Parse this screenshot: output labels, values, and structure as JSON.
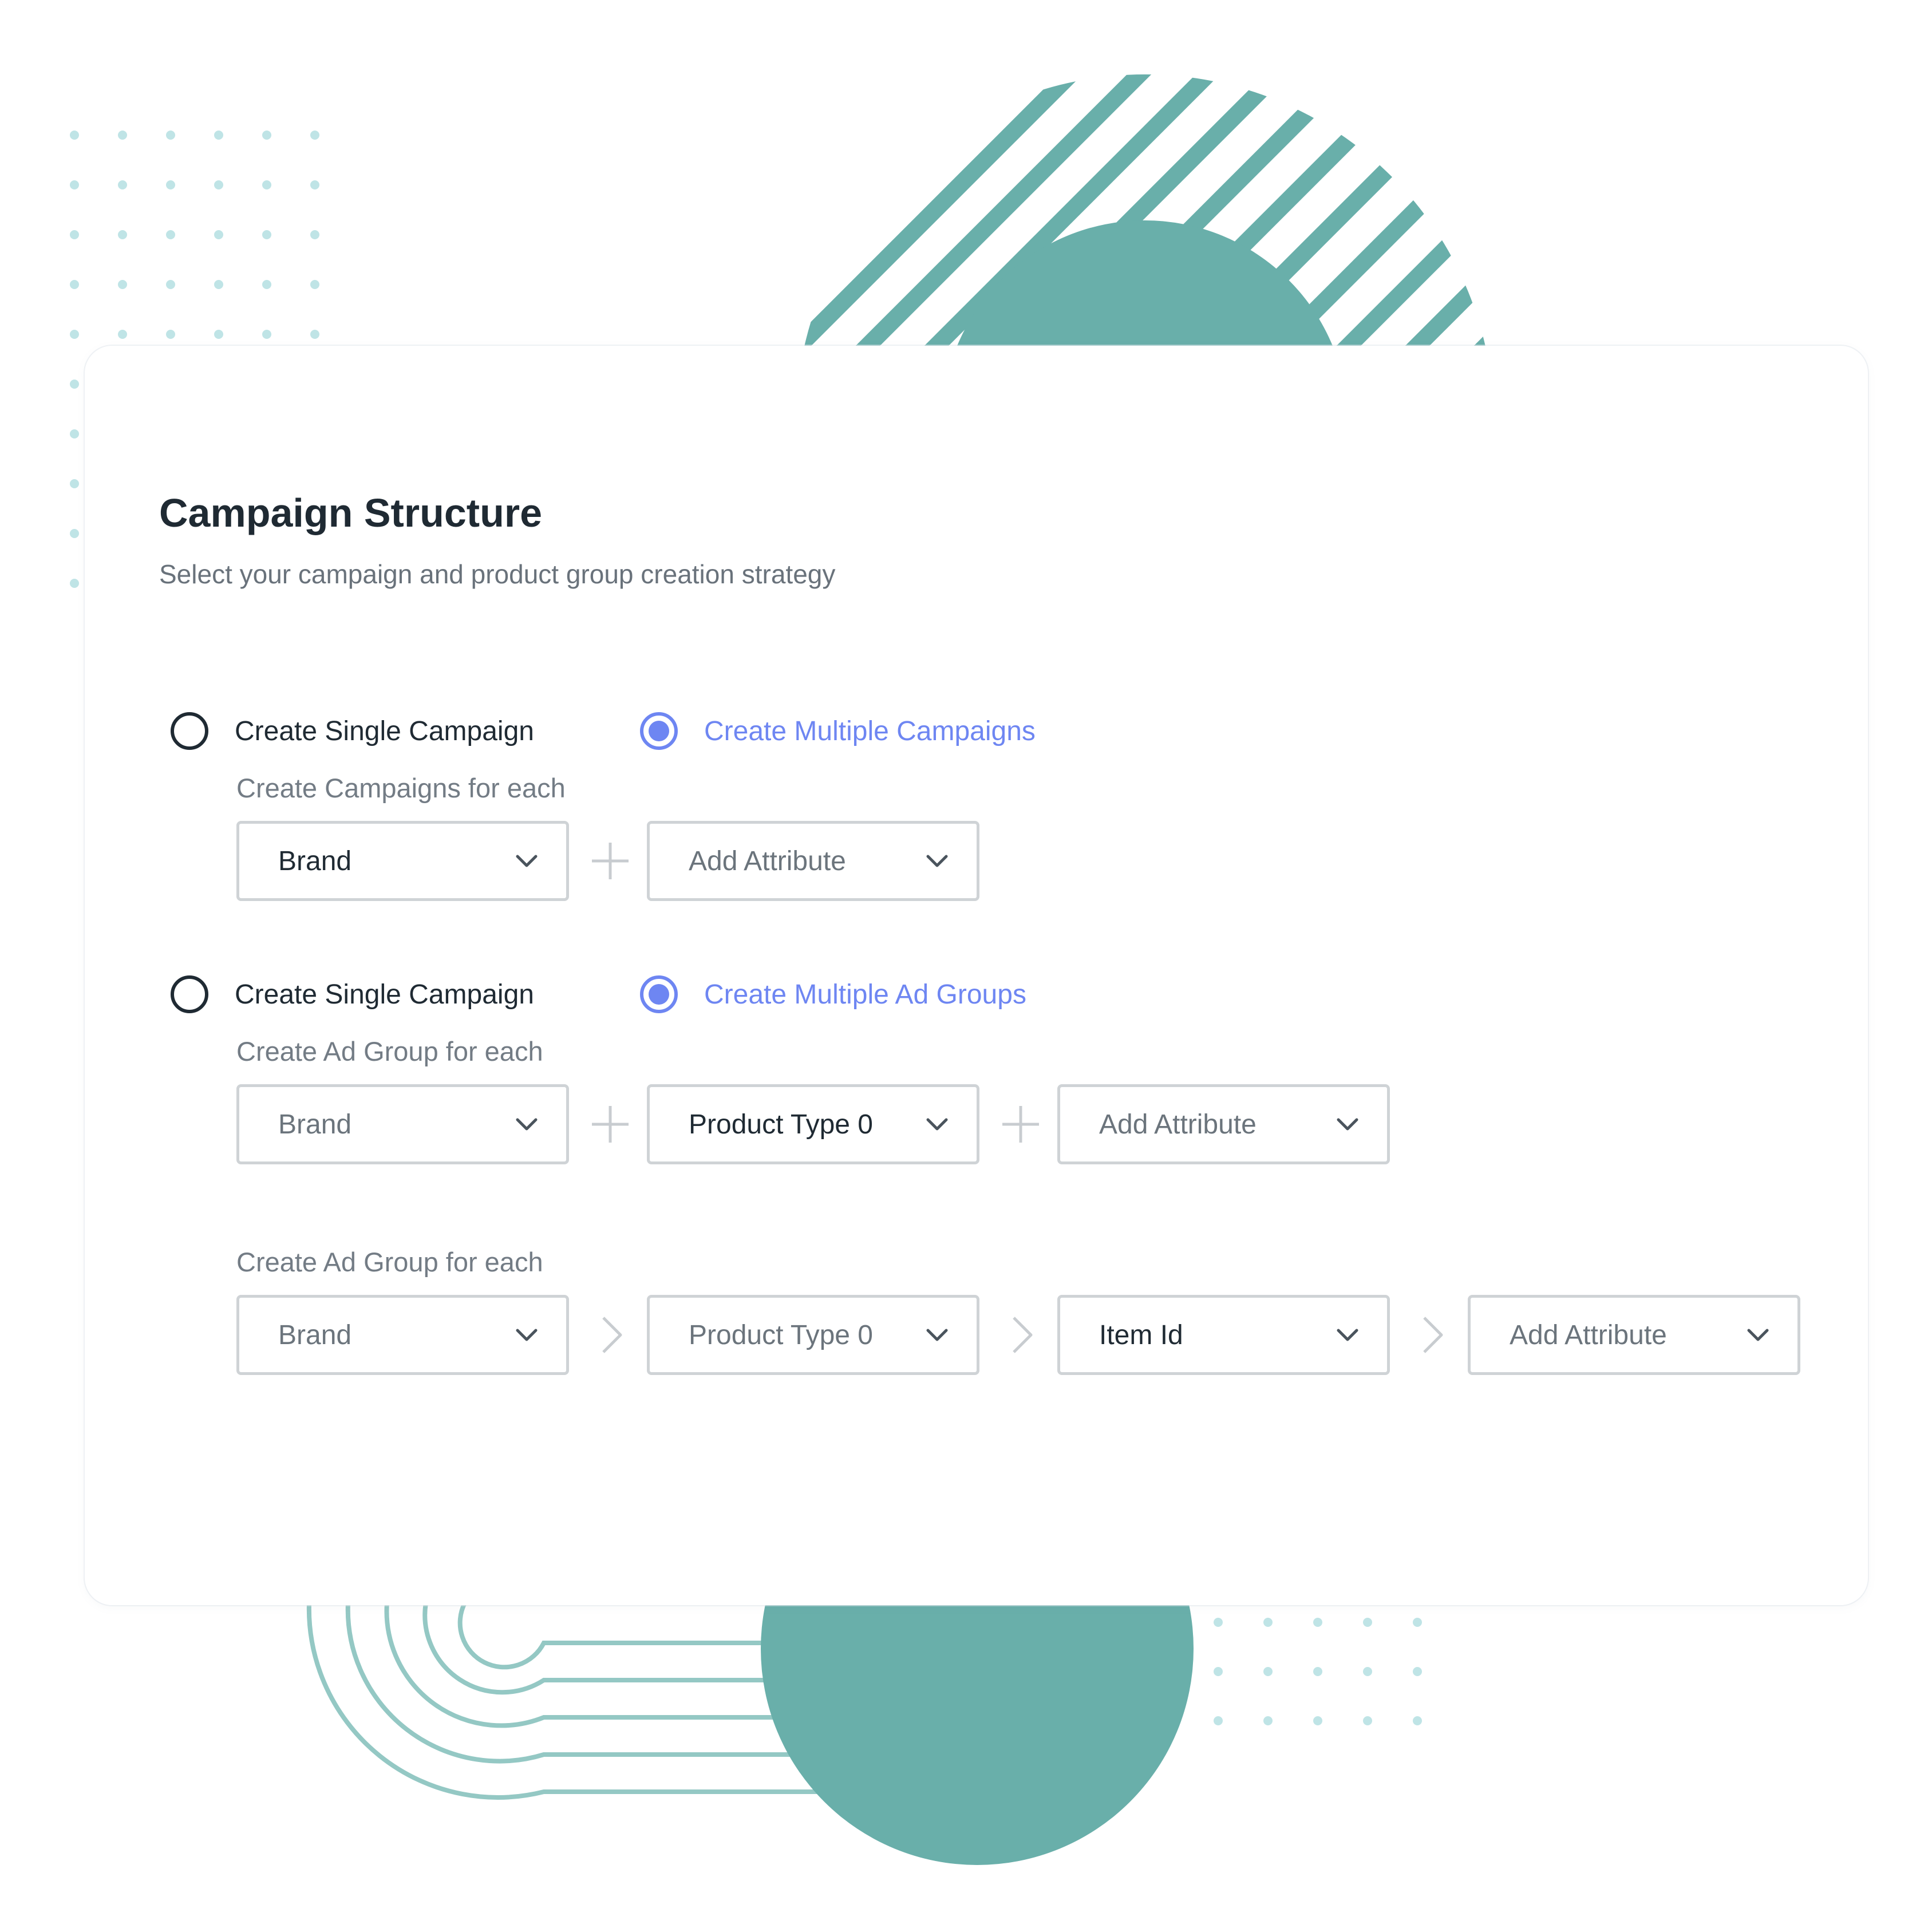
{
  "header": {
    "title": "Campaign Structure",
    "subtitle": "Select your campaign and product group creation strategy"
  },
  "colors": {
    "teal": "#69afaa",
    "dots": "#bfe4e6",
    "accent": "#6e86f2",
    "border": "#cfd3d6"
  },
  "campaigns_section": {
    "single_option": {
      "label": "Create Single Campaign",
      "selected": false
    },
    "multiple_option": {
      "label": "Create Multiple Campaigns",
      "selected": true
    },
    "group_label": "Create Campaigns for each",
    "dropdowns": [
      {
        "value": "Brand"
      },
      {
        "value": "Add Attribute"
      }
    ],
    "separator": "plus-icon"
  },
  "adgroups_section": {
    "single_option": {
      "label": "Create Single Campaign",
      "selected": false
    },
    "multiple_option": {
      "label": "Create Multiple Ad Groups",
      "selected": true
    },
    "group_label": "Create Ad Group for each",
    "dropdowns": [
      {
        "value": "Brand"
      },
      {
        "value": "Product Type 0"
      },
      {
        "value": "Add Attribute"
      }
    ],
    "separator": "plus-icon"
  },
  "hierarchy_section": {
    "group_label": "Create Ad Group for each",
    "dropdowns": [
      {
        "value": "Brand"
      },
      {
        "value": "Product Type 0"
      },
      {
        "value": "Item Id"
      },
      {
        "value": "Add Attribute"
      }
    ],
    "separator": "chevron-right-icon"
  }
}
